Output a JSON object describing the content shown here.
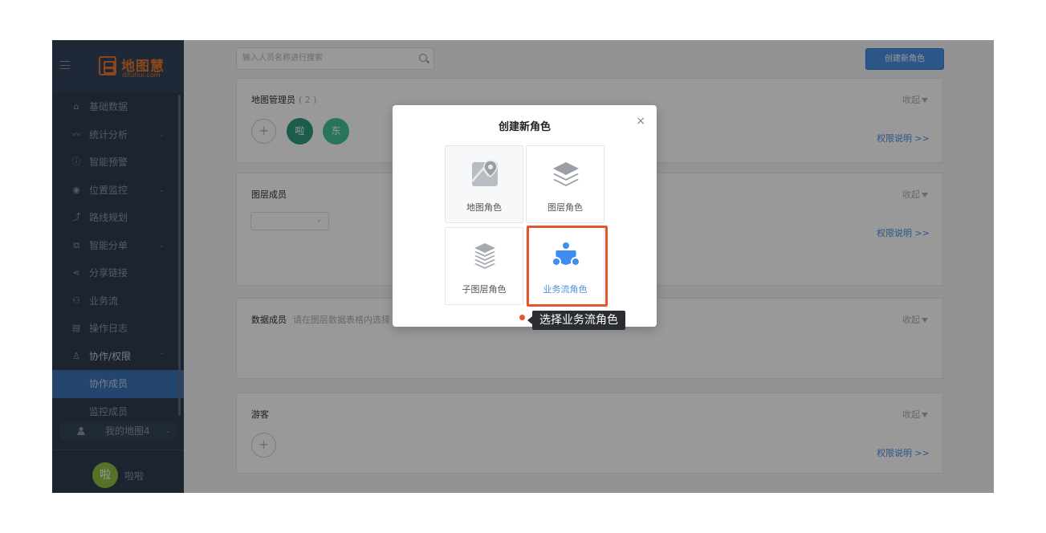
{
  "brand": {
    "name": "地图慧",
    "domain": "dituhui.com",
    "color": "#e8772e"
  },
  "sidebar": {
    "items": [
      {
        "label": "基础数据",
        "icon": "home-icon",
        "glyph": "⌂"
      },
      {
        "label": "统计分析",
        "icon": "chart-line-icon",
        "glyph": "〰",
        "chevron": "⌄"
      },
      {
        "label": "智能预警",
        "icon": "alert-circle-icon",
        "glyph": "ⓘ"
      },
      {
        "label": "位置监控",
        "icon": "location-icon",
        "glyph": "◉",
        "chevron": "⌄"
      },
      {
        "label": "路线规划",
        "icon": "route-icon",
        "glyph": "⤴"
      },
      {
        "label": "智能分单",
        "icon": "copy-icon",
        "glyph": "⧉",
        "chevron": "⌄"
      },
      {
        "label": "分享链接",
        "icon": "share-icon",
        "glyph": "⋖"
      },
      {
        "label": "业务流",
        "icon": "workflow-icon",
        "glyph": "⚇"
      },
      {
        "label": "操作日志",
        "icon": "log-icon",
        "glyph": "▤"
      },
      {
        "label": "协作/权限",
        "icon": "user-icon",
        "glyph": "♙",
        "chevron": "⌃",
        "open": true
      }
    ],
    "subitems": [
      {
        "label": "协作成员",
        "active": true
      },
      {
        "label": "监控成员",
        "active": false
      }
    ],
    "map_select": {
      "label": "我的地图4"
    },
    "user": {
      "avatar_char": "啦",
      "name": "啦啦"
    }
  },
  "main": {
    "search_placeholder": "输入人员名称进行搜索",
    "create_button": "创建新角色",
    "sections": [
      {
        "title": "地图管理员",
        "count": "( 2 )",
        "collapse": "收起",
        "perm": "权限说明 >>",
        "members": [
          {
            "char": "啦",
            "color": "#2e9a7e"
          },
          {
            "char": "东",
            "color": "#44c29a"
          }
        ]
      },
      {
        "title": "图层成员",
        "collapse": "收起",
        "perm": "权限说明 >>"
      },
      {
        "title": "数据成员",
        "hint": "请在图层数据表格内选择",
        "collapse": "收起"
      },
      {
        "title": "游客",
        "collapse": "收起",
        "perm": "权限说明 >>"
      }
    ]
  },
  "modal": {
    "title": "创建新角色",
    "close": "×",
    "roles": [
      {
        "label": "地图角色",
        "icon": "map-pin-icon"
      },
      {
        "label": "图层角色",
        "icon": "layers-icon"
      },
      {
        "label": "子图层角色",
        "icon": "sublayers-icon"
      },
      {
        "label": "业务流角色",
        "icon": "workflow-icon",
        "selected": true
      }
    ]
  },
  "annotation": {
    "tooltip": "选择业务流角色",
    "color": "#e4572e"
  },
  "colors": {
    "primary": "#4a90e2",
    "sidebar_bg": "#2f3d51",
    "active_item": "#3d74b8"
  }
}
